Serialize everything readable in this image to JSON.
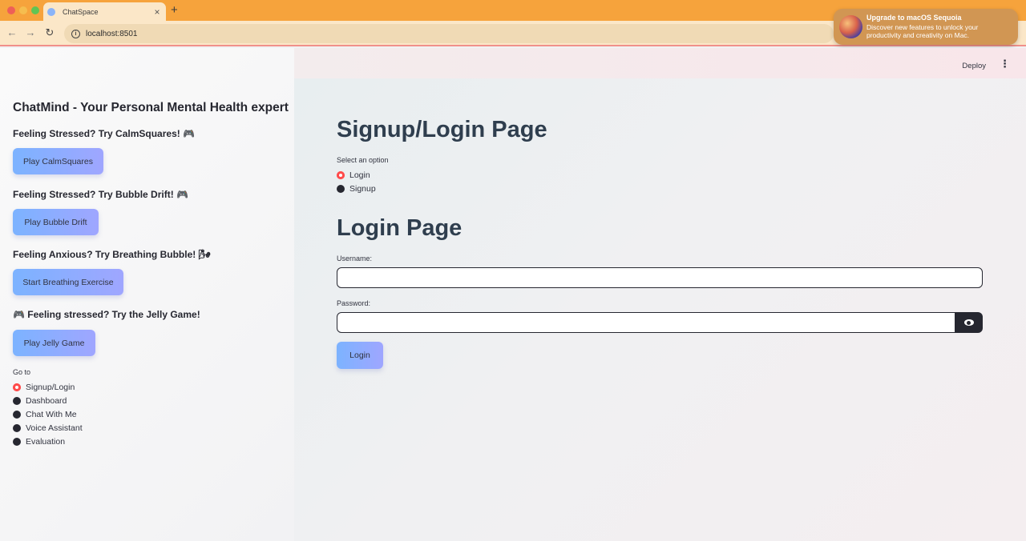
{
  "browser": {
    "tab_title": "ChatSpace",
    "tab_close": "×",
    "new_tab": "+",
    "url": "localhost:8501",
    "nav_back": "←",
    "nav_forward": "→",
    "nav_reload": "↻",
    "url_info": "i"
  },
  "notification": {
    "title": "Upgrade to macOS Sequoia",
    "body": "Discover new features to unlock your productivity and creativity on Mac."
  },
  "sidebar": {
    "title": "ChatMind - Your Personal Mental Health expert",
    "games": [
      {
        "heading": "Feeling Stressed? Try CalmSquares! 🎮",
        "button": "Play CalmSquares"
      },
      {
        "heading": "Feeling Stressed? Try Bubble Drift! 🎮",
        "button": "Play Bubble Drift"
      },
      {
        "heading": "Feeling Anxious? Try Breathing Bubble! 🌬",
        "button": "Start Breathing Exercise"
      },
      {
        "heading": "🎮 Feeling stressed? Try the Jelly Game!",
        "button": "Play Jelly Game"
      }
    ],
    "goto_label": "Go to",
    "nav_options": [
      "Signup/Login",
      "Dashboard",
      "Chat With Me",
      "Voice Assistant",
      "Evaluation"
    ],
    "nav_selected": "Signup/Login"
  },
  "header": {
    "deploy_label": "Deploy",
    "menu_label": "⋮"
  },
  "main": {
    "title": "Signup/Login Page",
    "option_label": "Select an option",
    "options": [
      "Login",
      "Signup"
    ],
    "option_selected": "Login",
    "section_title": "Login Page",
    "username_label": "Username:",
    "username_value": "",
    "password_label": "Password:",
    "password_value": "",
    "login_button": "Login"
  },
  "colors": {
    "browser_tabbar": "#f6a33c",
    "button_gradient_start": "#7cb3ff",
    "button_gradient_end": "#9fa6ff",
    "radio_selected": "#ff4b4b",
    "title_text": "#2f3e4e"
  }
}
